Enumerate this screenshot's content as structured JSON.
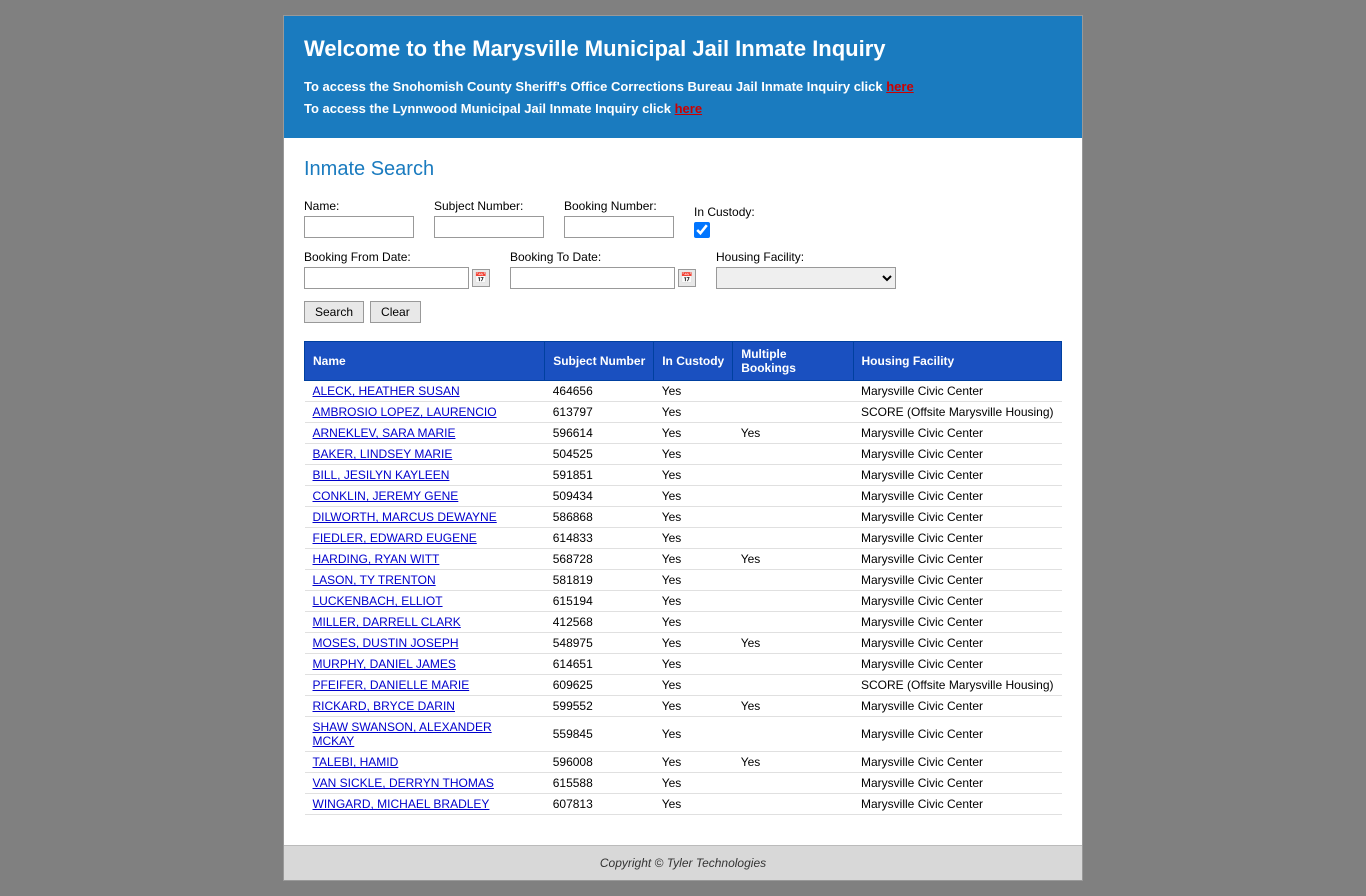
{
  "header": {
    "title": "Welcome to the Marysville Municipal Jail Inmate Inquiry",
    "line1_text": "To access the Snohomish County Sheriff's Office Corrections Bureau Jail Inmate Inquiry click ",
    "line1_link": "here",
    "line2_text": "To access the Lynnwood Municipal Jail Inmate Inquiry click ",
    "line2_link": "here"
  },
  "search_section": {
    "title": "Inmate Search",
    "labels": {
      "name": "Name:",
      "subject_number": "Subject Number:",
      "booking_number": "Booking Number:",
      "in_custody": "In Custody:",
      "booking_from": "Booking From Date:",
      "booking_to": "Booking To Date:",
      "housing_facility": "Housing Facility:"
    },
    "buttons": {
      "search": "Search",
      "clear": "Clear"
    }
  },
  "table": {
    "headers": [
      "Name",
      "Subject Number",
      "In Custody",
      "Multiple Bookings",
      "Housing Facility"
    ],
    "rows": [
      {
        "name": "ALECK, HEATHER SUSAN",
        "subject": "464656",
        "in_custody": "Yes",
        "multiple": "",
        "housing": "Marysville Civic Center"
      },
      {
        "name": "AMBROSIO LOPEZ, LAURENCIO",
        "subject": "613797",
        "in_custody": "Yes",
        "multiple": "",
        "housing": "SCORE (Offsite Marysville Housing)"
      },
      {
        "name": "ARNEKLEV, SARA MARIE",
        "subject": "596614",
        "in_custody": "Yes",
        "multiple": "Yes",
        "housing": "Marysville Civic Center"
      },
      {
        "name": "BAKER, LINDSEY MARIE",
        "subject": "504525",
        "in_custody": "Yes",
        "multiple": "",
        "housing": "Marysville Civic Center"
      },
      {
        "name": "BILL, JESILYN KAYLEEN",
        "subject": "591851",
        "in_custody": "Yes",
        "multiple": "",
        "housing": "Marysville Civic Center"
      },
      {
        "name": "CONKLIN, JEREMY GENE",
        "subject": "509434",
        "in_custody": "Yes",
        "multiple": "",
        "housing": "Marysville Civic Center"
      },
      {
        "name": "DILWORTH, MARCUS DEWAYNE",
        "subject": "586868",
        "in_custody": "Yes",
        "multiple": "",
        "housing": "Marysville Civic Center"
      },
      {
        "name": "FIEDLER, EDWARD EUGENE",
        "subject": "614833",
        "in_custody": "Yes",
        "multiple": "",
        "housing": "Marysville Civic Center"
      },
      {
        "name": "HARDING, RYAN WITT",
        "subject": "568728",
        "in_custody": "Yes",
        "multiple": "Yes",
        "housing": "Marysville Civic Center"
      },
      {
        "name": "LASON, TY TRENTON",
        "subject": "581819",
        "in_custody": "Yes",
        "multiple": "",
        "housing": "Marysville Civic Center"
      },
      {
        "name": "LUCKENBACH, ELLIOT",
        "subject": "615194",
        "in_custody": "Yes",
        "multiple": "",
        "housing": "Marysville Civic Center"
      },
      {
        "name": "MILLER, DARRELL CLARK",
        "subject": "412568",
        "in_custody": "Yes",
        "multiple": "",
        "housing": "Marysville Civic Center"
      },
      {
        "name": "MOSES, DUSTIN JOSEPH",
        "subject": "548975",
        "in_custody": "Yes",
        "multiple": "Yes",
        "housing": "Marysville Civic Center"
      },
      {
        "name": "MURPHY, DANIEL JAMES",
        "subject": "614651",
        "in_custody": "Yes",
        "multiple": "",
        "housing": "Marysville Civic Center"
      },
      {
        "name": "PFEIFER, DANIELLE MARIE",
        "subject": "609625",
        "in_custody": "Yes",
        "multiple": "",
        "housing": "SCORE (Offsite Marysville Housing)"
      },
      {
        "name": "RICKARD, BRYCE DARIN",
        "subject": "599552",
        "in_custody": "Yes",
        "multiple": "Yes",
        "housing": "Marysville Civic Center"
      },
      {
        "name": "SHAW SWANSON, ALEXANDER MCKAY",
        "subject": "559845",
        "in_custody": "Yes",
        "multiple": "",
        "housing": "Marysville Civic Center"
      },
      {
        "name": "TALEBI, HAMID",
        "subject": "596008",
        "in_custody": "Yes",
        "multiple": "Yes",
        "housing": "Marysville Civic Center"
      },
      {
        "name": "VAN SICKLE, DERRYN THOMAS",
        "subject": "615588",
        "in_custody": "Yes",
        "multiple": "",
        "housing": "Marysville Civic Center"
      },
      {
        "name": "WINGARD, MICHAEL BRADLEY",
        "subject": "607813",
        "in_custody": "Yes",
        "multiple": "",
        "housing": "Marysville Civic Center"
      }
    ]
  },
  "footer": {
    "copyright": "Copyright © Tyler Technologies"
  }
}
